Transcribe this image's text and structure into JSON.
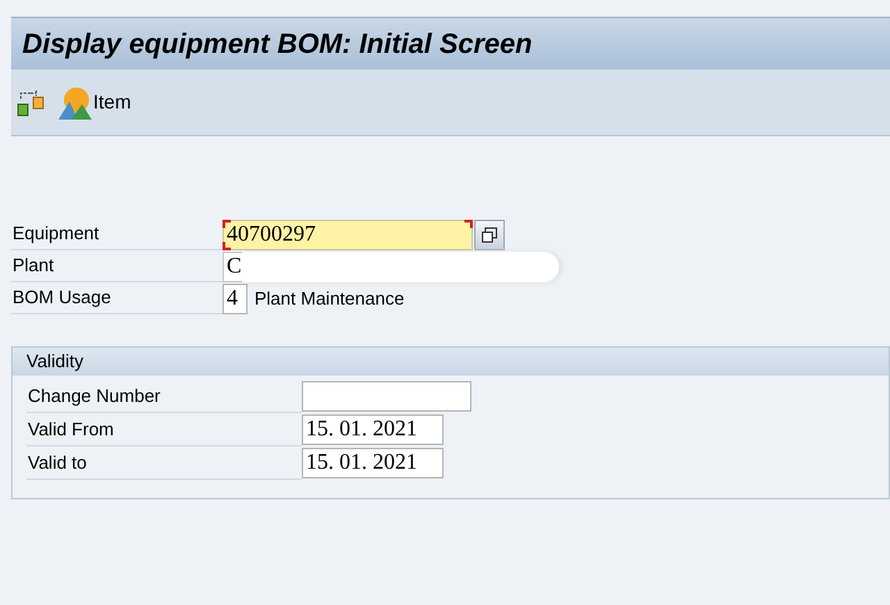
{
  "window": {
    "title": "Display equipment BOM: Initial Screen"
  },
  "toolbar": {
    "item_button": "Item"
  },
  "fields": [
    {
      "label": "Equipment",
      "value": "40700297",
      "required": true,
      "value_help": true
    },
    {
      "label": "Plant",
      "value": "C",
      "required": false,
      "redacted": true
    },
    {
      "label": "BOM Usage",
      "value": "4",
      "required": false,
      "description": "Plant Maintenance"
    }
  ],
  "validity": {
    "title": "Validity",
    "fields": [
      {
        "label": "Change Number"
      },
      {
        "label": "Valid From",
        "value": "15. 01. 2021"
      },
      {
        "label": "Valid to",
        "value": "15. 01. 2021"
      }
    ]
  }
}
